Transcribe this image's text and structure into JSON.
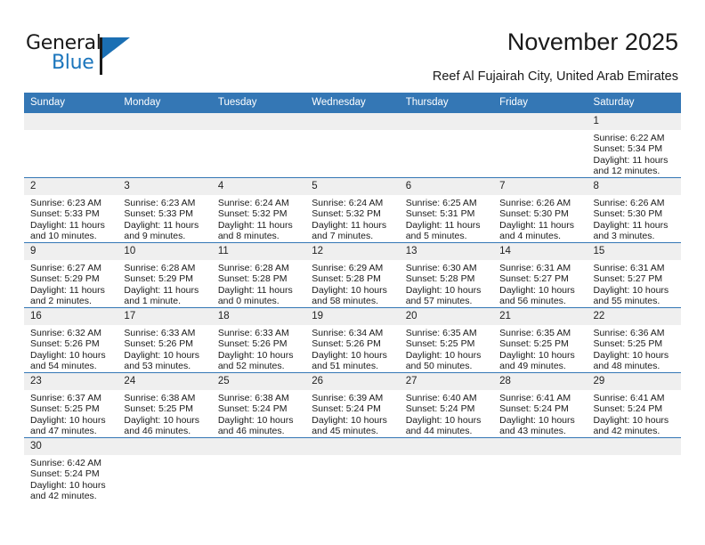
{
  "brand": {
    "name_part1": "General",
    "name_part2": "Blue",
    "logo_icon": "triangle-flag-icon"
  },
  "header": {
    "title": "November 2025",
    "subtitle": "Reef Al Fujairah City, United Arab Emirates"
  },
  "colors": {
    "header_blue": "#3477b5",
    "logo_blue": "#1b75bc",
    "daynum_bg": "#efefef",
    "cell_bg": "#ffffff",
    "text": "#1a1a1a"
  },
  "weekday_headers": [
    "Sunday",
    "Monday",
    "Tuesday",
    "Wednesday",
    "Thursday",
    "Friday",
    "Saturday"
  ],
  "weeks": [
    [
      {
        "blank": true
      },
      {
        "blank": true
      },
      {
        "blank": true
      },
      {
        "blank": true
      },
      {
        "blank": true
      },
      {
        "blank": true
      },
      {
        "day": "1",
        "sunrise": "Sunrise: 6:22 AM",
        "sunset": "Sunset: 5:34 PM",
        "daylight_line1": "Daylight: 11 hours",
        "daylight_line2": "and 12 minutes."
      }
    ],
    [
      {
        "day": "2",
        "sunrise": "Sunrise: 6:23 AM",
        "sunset": "Sunset: 5:33 PM",
        "daylight_line1": "Daylight: 11 hours",
        "daylight_line2": "and 10 minutes."
      },
      {
        "day": "3",
        "sunrise": "Sunrise: 6:23 AM",
        "sunset": "Sunset: 5:33 PM",
        "daylight_line1": "Daylight: 11 hours",
        "daylight_line2": "and 9 minutes."
      },
      {
        "day": "4",
        "sunrise": "Sunrise: 6:24 AM",
        "sunset": "Sunset: 5:32 PM",
        "daylight_line1": "Daylight: 11 hours",
        "daylight_line2": "and 8 minutes."
      },
      {
        "day": "5",
        "sunrise": "Sunrise: 6:24 AM",
        "sunset": "Sunset: 5:32 PM",
        "daylight_line1": "Daylight: 11 hours",
        "daylight_line2": "and 7 minutes."
      },
      {
        "day": "6",
        "sunrise": "Sunrise: 6:25 AM",
        "sunset": "Sunset: 5:31 PM",
        "daylight_line1": "Daylight: 11 hours",
        "daylight_line2": "and 5 minutes."
      },
      {
        "day": "7",
        "sunrise": "Sunrise: 6:26 AM",
        "sunset": "Sunset: 5:30 PM",
        "daylight_line1": "Daylight: 11 hours",
        "daylight_line2": "and 4 minutes."
      },
      {
        "day": "8",
        "sunrise": "Sunrise: 6:26 AM",
        "sunset": "Sunset: 5:30 PM",
        "daylight_line1": "Daylight: 11 hours",
        "daylight_line2": "and 3 minutes."
      }
    ],
    [
      {
        "day": "9",
        "sunrise": "Sunrise: 6:27 AM",
        "sunset": "Sunset: 5:29 PM",
        "daylight_line1": "Daylight: 11 hours",
        "daylight_line2": "and 2 minutes."
      },
      {
        "day": "10",
        "sunrise": "Sunrise: 6:28 AM",
        "sunset": "Sunset: 5:29 PM",
        "daylight_line1": "Daylight: 11 hours",
        "daylight_line2": "and 1 minute."
      },
      {
        "day": "11",
        "sunrise": "Sunrise: 6:28 AM",
        "sunset": "Sunset: 5:28 PM",
        "daylight_line1": "Daylight: 11 hours",
        "daylight_line2": "and 0 minutes."
      },
      {
        "day": "12",
        "sunrise": "Sunrise: 6:29 AM",
        "sunset": "Sunset: 5:28 PM",
        "daylight_line1": "Daylight: 10 hours",
        "daylight_line2": "and 58 minutes."
      },
      {
        "day": "13",
        "sunrise": "Sunrise: 6:30 AM",
        "sunset": "Sunset: 5:28 PM",
        "daylight_line1": "Daylight: 10 hours",
        "daylight_line2": "and 57 minutes."
      },
      {
        "day": "14",
        "sunrise": "Sunrise: 6:31 AM",
        "sunset": "Sunset: 5:27 PM",
        "daylight_line1": "Daylight: 10 hours",
        "daylight_line2": "and 56 minutes."
      },
      {
        "day": "15",
        "sunrise": "Sunrise: 6:31 AM",
        "sunset": "Sunset: 5:27 PM",
        "daylight_line1": "Daylight: 10 hours",
        "daylight_line2": "and 55 minutes."
      }
    ],
    [
      {
        "day": "16",
        "sunrise": "Sunrise: 6:32 AM",
        "sunset": "Sunset: 5:26 PM",
        "daylight_line1": "Daylight: 10 hours",
        "daylight_line2": "and 54 minutes."
      },
      {
        "day": "17",
        "sunrise": "Sunrise: 6:33 AM",
        "sunset": "Sunset: 5:26 PM",
        "daylight_line1": "Daylight: 10 hours",
        "daylight_line2": "and 53 minutes."
      },
      {
        "day": "18",
        "sunrise": "Sunrise: 6:33 AM",
        "sunset": "Sunset: 5:26 PM",
        "daylight_line1": "Daylight: 10 hours",
        "daylight_line2": "and 52 minutes."
      },
      {
        "day": "19",
        "sunrise": "Sunrise: 6:34 AM",
        "sunset": "Sunset: 5:26 PM",
        "daylight_line1": "Daylight: 10 hours",
        "daylight_line2": "and 51 minutes."
      },
      {
        "day": "20",
        "sunrise": "Sunrise: 6:35 AM",
        "sunset": "Sunset: 5:25 PM",
        "daylight_line1": "Daylight: 10 hours",
        "daylight_line2": "and 50 minutes."
      },
      {
        "day": "21",
        "sunrise": "Sunrise: 6:35 AM",
        "sunset": "Sunset: 5:25 PM",
        "daylight_line1": "Daylight: 10 hours",
        "daylight_line2": "and 49 minutes."
      },
      {
        "day": "22",
        "sunrise": "Sunrise: 6:36 AM",
        "sunset": "Sunset: 5:25 PM",
        "daylight_line1": "Daylight: 10 hours",
        "daylight_line2": "and 48 minutes."
      }
    ],
    [
      {
        "day": "23",
        "sunrise": "Sunrise: 6:37 AM",
        "sunset": "Sunset: 5:25 PM",
        "daylight_line1": "Daylight: 10 hours",
        "daylight_line2": "and 47 minutes."
      },
      {
        "day": "24",
        "sunrise": "Sunrise: 6:38 AM",
        "sunset": "Sunset: 5:25 PM",
        "daylight_line1": "Daylight: 10 hours",
        "daylight_line2": "and 46 minutes."
      },
      {
        "day": "25",
        "sunrise": "Sunrise: 6:38 AM",
        "sunset": "Sunset: 5:24 PM",
        "daylight_line1": "Daylight: 10 hours",
        "daylight_line2": "and 46 minutes."
      },
      {
        "day": "26",
        "sunrise": "Sunrise: 6:39 AM",
        "sunset": "Sunset: 5:24 PM",
        "daylight_line1": "Daylight: 10 hours",
        "daylight_line2": "and 45 minutes."
      },
      {
        "day": "27",
        "sunrise": "Sunrise: 6:40 AM",
        "sunset": "Sunset: 5:24 PM",
        "daylight_line1": "Daylight: 10 hours",
        "daylight_line2": "and 44 minutes."
      },
      {
        "day": "28",
        "sunrise": "Sunrise: 6:41 AM",
        "sunset": "Sunset: 5:24 PM",
        "daylight_line1": "Daylight: 10 hours",
        "daylight_line2": "and 43 minutes."
      },
      {
        "day": "29",
        "sunrise": "Sunrise: 6:41 AM",
        "sunset": "Sunset: 5:24 PM",
        "daylight_line1": "Daylight: 10 hours",
        "daylight_line2": "and 42 minutes."
      }
    ],
    [
      {
        "day": "30",
        "sunrise": "Sunrise: 6:42 AM",
        "sunset": "Sunset: 5:24 PM",
        "daylight_line1": "Daylight: 10 hours",
        "daylight_line2": "and 42 minutes."
      },
      {
        "blank": true
      },
      {
        "blank": true
      },
      {
        "blank": true
      },
      {
        "blank": true
      },
      {
        "blank": true
      },
      {
        "blank": true
      }
    ]
  ]
}
